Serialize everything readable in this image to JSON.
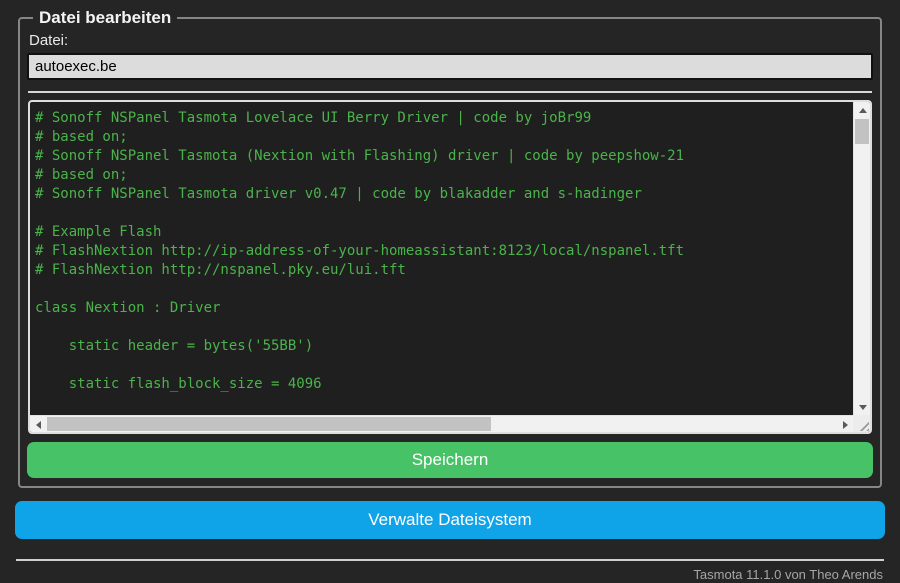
{
  "editor": {
    "legend": "Datei bearbeiten",
    "file_label": "Datei:",
    "filename": "autoexec.be",
    "code": "# Sonoff NSPanel Tasmota Lovelace UI Berry Driver | code by joBr99\n# based on;\n# Sonoff NSPanel Tasmota (Nextion with Flashing) driver | code by peepshow-21\n# based on;\n# Sonoff NSPanel Tasmota driver v0.47 | code by blakadder and s-hadinger\n\n# Example Flash\n# FlashNextion http://ip-address-of-your-homeassistant:8123/local/nspanel.tft\n# FlashNextion http://nspanel.pky.eu/lui.tft\n\nclass Nextion : Driver\n\n    static header = bytes('55BB')\n\n    static flash_block_size = 4096",
    "save_button": "Speichern"
  },
  "actions": {
    "manage_filesystem_button": "Verwalte Dateisystem"
  },
  "footer": {
    "text": "Tasmota 11.1.0 von Theo Arends"
  },
  "colors": {
    "page_bg": "#252525",
    "console_bg": "#1f1f1f",
    "console_text": "#4bb34b",
    "save_button": "#47c266",
    "manage_button": "#0fa3e8",
    "input_bg": "#dcdcdc",
    "fieldset_border": "#868686"
  }
}
